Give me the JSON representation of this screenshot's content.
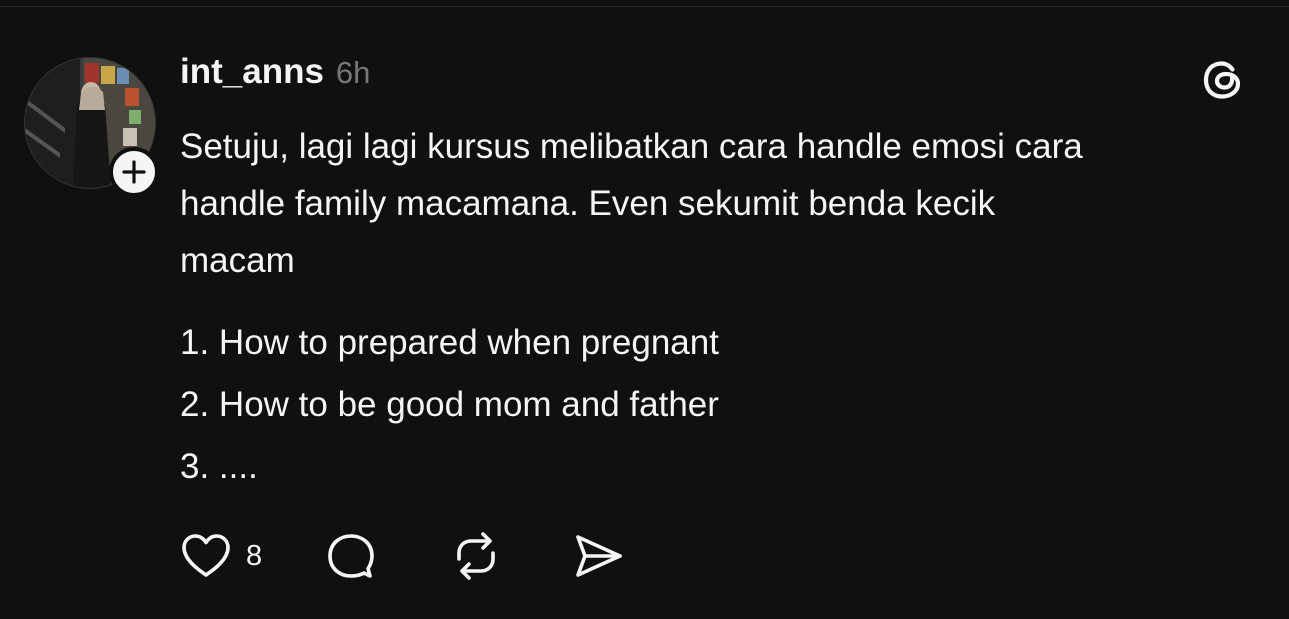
{
  "post": {
    "username": "int_anns",
    "timestamp": "6h",
    "body_lines": [
      "Setuju, lagi lagi kursus melibatkan cara handle emosi cara",
      "handle family macamana. Even sekumit benda kecik",
      "macam"
    ],
    "list": [
      "1. How to prepared when pregnant",
      "2. How to be good mom and father",
      "3. ...."
    ],
    "like_count": "8"
  },
  "icons": {
    "follow": "plus-icon",
    "logo": "threads-logo-icon",
    "like": "heart-icon",
    "comment": "speech-bubble-icon",
    "repost": "repost-icon",
    "share": "send-icon"
  },
  "colors": {
    "background": "#101010",
    "text": "#f3f5f7",
    "muted": "#777777"
  }
}
